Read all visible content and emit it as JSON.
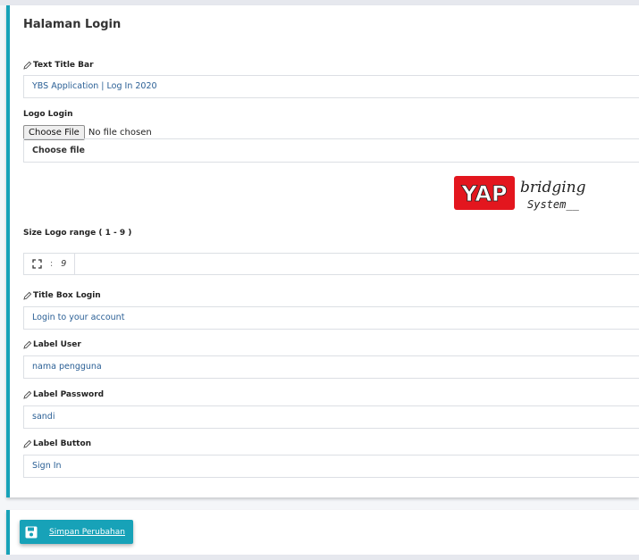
{
  "card": {
    "title": "Halaman Login"
  },
  "fields": {
    "title_bar": {
      "label": "Text Title Bar",
      "value": "YBS Application | Log In 2020"
    },
    "logo": {
      "label": "Logo Login",
      "file_button": "Choose File",
      "file_status": "No file chosen",
      "choose_text": "Choose file",
      "image_text_1": "YAP",
      "image_text_2": "bridging",
      "image_text_3": "System__"
    },
    "size_logo": {
      "label": "Size Logo range ( 1 - 9 )",
      "separator": ":",
      "value": "9",
      "icon": "expand-icon"
    },
    "title_box": {
      "label": "Title Box Login",
      "value": "Login to your account"
    },
    "label_user": {
      "label": "Label User",
      "value": "nama pengguna"
    },
    "label_password": {
      "label": "Label Password",
      "value": "sandi"
    },
    "label_button": {
      "label": "Label Button",
      "value": "Sign In"
    }
  },
  "actions": {
    "save_label": "Simpan Perubahan",
    "save_icon": "floppy-disk-icon"
  },
  "colors": {
    "accent": "#17a2b8",
    "logo_red": "#e3161e",
    "field_text": "#2a5f95"
  }
}
